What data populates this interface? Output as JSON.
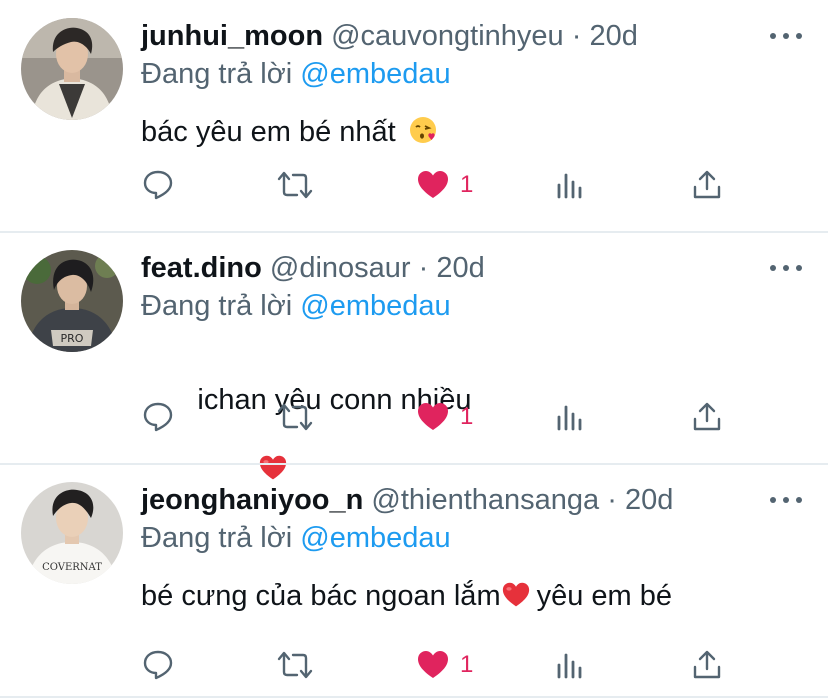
{
  "reply_prefix": "Đang trả lời",
  "colors": {
    "text": "#0f1419",
    "muted": "#536471",
    "link": "#1d9bf0",
    "like": "#e0245e",
    "divider": "#e6ecf0"
  },
  "icons": [
    "reply-icon",
    "retweet-icon",
    "like-icon",
    "analytics-icon",
    "share-icon",
    "more-icon"
  ],
  "tweets": [
    {
      "display_name": "junhui_moon",
      "handle": "@cauvongtinhyeu",
      "separator": "·",
      "age": "20d",
      "reply_to": "@embedau",
      "text": "bác yêu em bé nhất",
      "emoji": "face-blowing-kiss",
      "like_count": "1"
    },
    {
      "display_name": "feat.dino",
      "handle": "@dinosaur",
      "separator": "·",
      "age": "20d",
      "reply_to": "@embedau",
      "text": " ichan yêu conn nhiều",
      "emoji": "red-heart",
      "like_count": "1"
    },
    {
      "display_name": "jeonghaniyoo_n",
      "handle": "@thienthansanga",
      "separator": "·",
      "age": "20d",
      "reply_to": "@embedau",
      "text_before": "bé cưng của bác ngoan lắm",
      "emoji": "red-heart",
      "text_after": "yêu em bé",
      "like_count": "1"
    }
  ]
}
